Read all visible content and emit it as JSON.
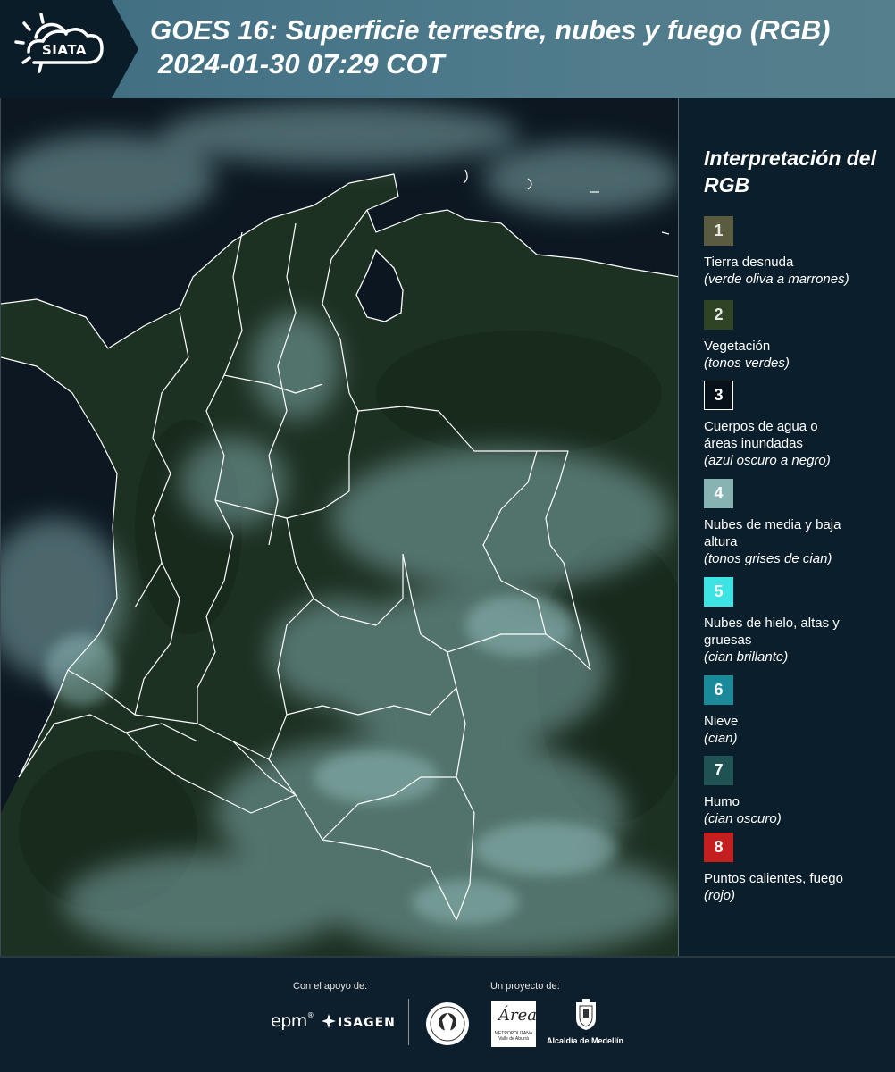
{
  "header": {
    "logo_text": "SIATA",
    "title_line1": "GOES 16: Superficie terrestre, nubes y fuego (RGB)",
    "title_line2": "2024-01-30 07:29 COT"
  },
  "legend": {
    "title": "Interpretación del RGB",
    "items": [
      {
        "number": "1",
        "label": "Tierra desnuda",
        "sub": "(verde oliva a marrones)",
        "color": "#5b5b40",
        "text_color": "#e8e8e8",
        "border": "none"
      },
      {
        "number": "2",
        "label": "Vegetación",
        "sub": "(tonos verdes)",
        "color": "#2f4424",
        "text_color": "#e8e8e8",
        "border": "none"
      },
      {
        "number": "3",
        "label": "Cuerpos de agua o áreas inundadas",
        "sub": "(azul oscuro a negro)",
        "color": "#07111a",
        "text_color": "#ffffff",
        "border": "#ffffff"
      },
      {
        "number": "4",
        "label": "Nubes de media y baja altura",
        "sub": "(tonos grises de cian)",
        "color": "#87b3b3",
        "text_color": "#ffffff",
        "border": "none"
      },
      {
        "number": "5",
        "label": "Nubes de hielo, altas y gruesas",
        "sub": "(cian brillante)",
        "color": "#3ee3e3",
        "text_color": "#ffffff",
        "border": "none"
      },
      {
        "number": "6",
        "label": "Nieve",
        "sub": "(cian)",
        "color": "#1a8a9a",
        "text_color": "#ffffff",
        "border": "none"
      },
      {
        "number": "7",
        "label": "Humo",
        "sub": "(cian oscuro)",
        "color": "#1f5252",
        "text_color": "#ffffff",
        "border": "none"
      },
      {
        "number": "8",
        "label": "Puntos calientes, fuego",
        "sub": "(rojo)",
        "color": "#c51e1e",
        "text_color": "#ffffff",
        "border": "none"
      }
    ]
  },
  "footer": {
    "support_label": "Con el apoyo de:",
    "project_label": "Un proyecto de:",
    "epm": "epm",
    "epm_reg": "®",
    "isagen": "ISAGEN",
    "metro_script": "Área",
    "metro_text": "METROPOLITANA Valle de Aburrá",
    "alcaldia": "Alcaldía de Medellín"
  },
  "colors": {
    "header_band": "#4d7a8b",
    "logo_box": "#0b1c29",
    "legend_bg": "#0b1e2b",
    "map_ocean": "#0b1620",
    "map_land": "#1e3322",
    "clouds": "#7fa9aa",
    "borders": "#ffffff"
  }
}
